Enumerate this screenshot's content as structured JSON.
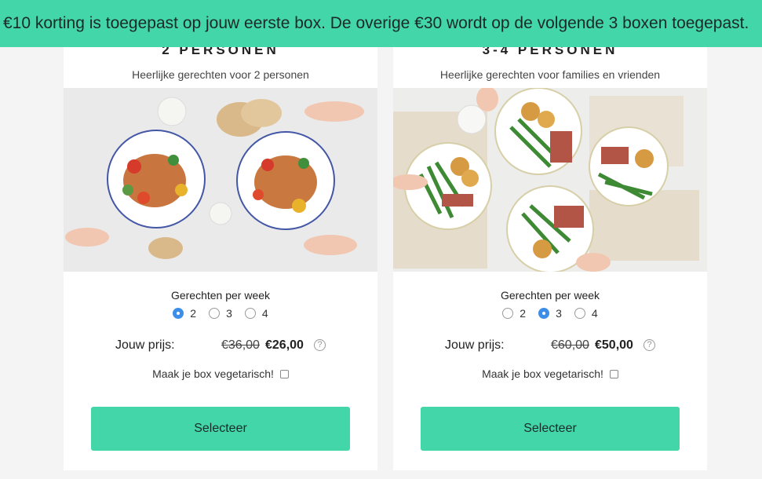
{
  "banner": {
    "text": "€10 korting is toegepast op jouw eerste box. De overige €30 wordt op de volgende 3 boxen toegepast."
  },
  "colors": {
    "accent": "#43d6a8",
    "radio_selected": "#3d8ee8"
  },
  "plans": [
    {
      "title": "2 PERSONEN",
      "subtitle": "Heerlijke gerechten voor 2 personen",
      "per_week_label": "Gerechten per week",
      "options": [
        "2",
        "3",
        "4"
      ],
      "selected": "2",
      "price_label": "Jouw prijs:",
      "old_price": "€36,00",
      "new_price": "€26,00",
      "help_symbol": "?",
      "veg_label": "Maak je box vegetarisch!",
      "veg_checked": false,
      "button_label": "Selecteer"
    },
    {
      "title": "3-4 PERSONEN",
      "subtitle": "Heerlijke gerechten voor families en vrienden",
      "per_week_label": "Gerechten per week",
      "options": [
        "2",
        "3",
        "4"
      ],
      "selected": "3",
      "price_label": "Jouw prijs:",
      "old_price": "€60,00",
      "new_price": "€50,00",
      "help_symbol": "?",
      "veg_label": "Maak je box vegetarisch!",
      "veg_checked": false,
      "button_label": "Selecteer"
    }
  ]
}
